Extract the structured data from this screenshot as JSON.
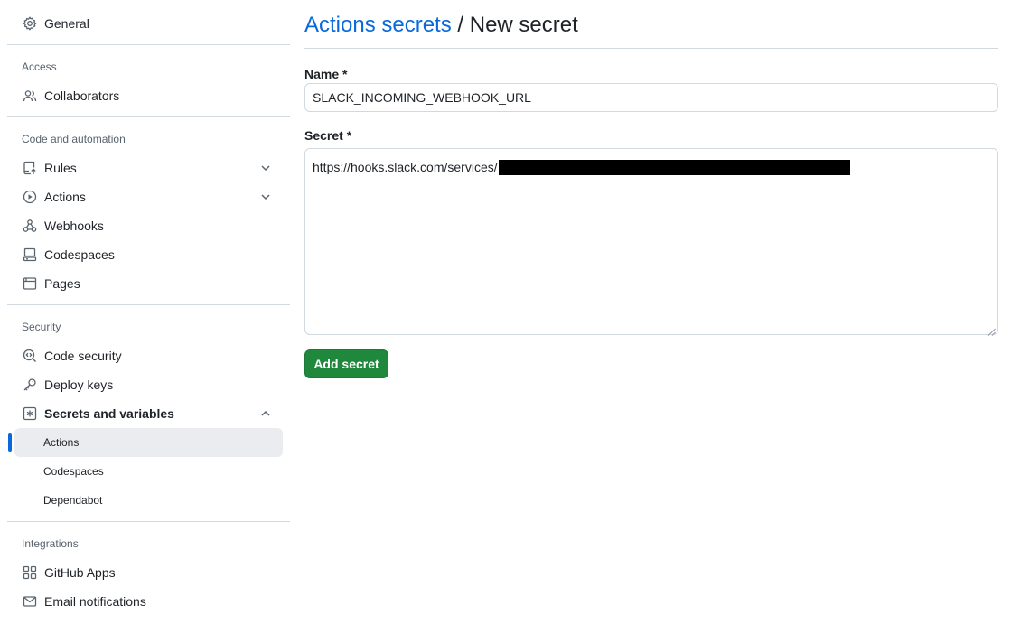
{
  "sidebar": {
    "general": {
      "label": "General",
      "icon": "gear-icon"
    },
    "groups": {
      "access": "Access",
      "code_automation": "Code and automation",
      "security": "Security",
      "integrations": "Integrations"
    },
    "collaborators": {
      "label": "Collaborators",
      "icon": "people-icon"
    },
    "rules": {
      "label": "Rules",
      "icon": "repo-push-icon"
    },
    "actions": {
      "label": "Actions",
      "icon": "play-icon"
    },
    "webhooks": {
      "label": "Webhooks",
      "icon": "webhook-icon"
    },
    "codespaces": {
      "label": "Codespaces",
      "icon": "codespaces-icon"
    },
    "pages": {
      "label": "Pages",
      "icon": "browser-icon"
    },
    "code_security": {
      "label": "Code security",
      "icon": "codescan-icon"
    },
    "deploy_keys": {
      "label": "Deploy keys",
      "icon": "key-icon"
    },
    "secrets": {
      "label": "Secrets and variables",
      "icon": "asterisk-icon",
      "sub_items": [
        "Actions",
        "Codespaces",
        "Dependabot"
      ],
      "active_sub_item": "Actions"
    },
    "github_apps": {
      "label": "GitHub Apps",
      "icon": "apps-icon"
    },
    "email_notifications": {
      "label": "Email notifications",
      "icon": "mail-icon"
    }
  },
  "main": {
    "breadcrumb_link": "Actions secrets",
    "breadcrumb_separator": " / ",
    "title": "New secret",
    "name_label": "Name *",
    "name_value": "SLACK_INCOMING_WEBHOOK_URL",
    "secret_label": "Secret *",
    "secret_value_visible": "https://hooks.slack.com/services/",
    "secret_redacted": true,
    "submit_label": "Add secret"
  },
  "colors": {
    "accent": "#0969da",
    "primary_button": "#1f883d",
    "active_item_bg": "#eaecef",
    "border": "#d1d9e0",
    "muted_text": "#59636e"
  }
}
